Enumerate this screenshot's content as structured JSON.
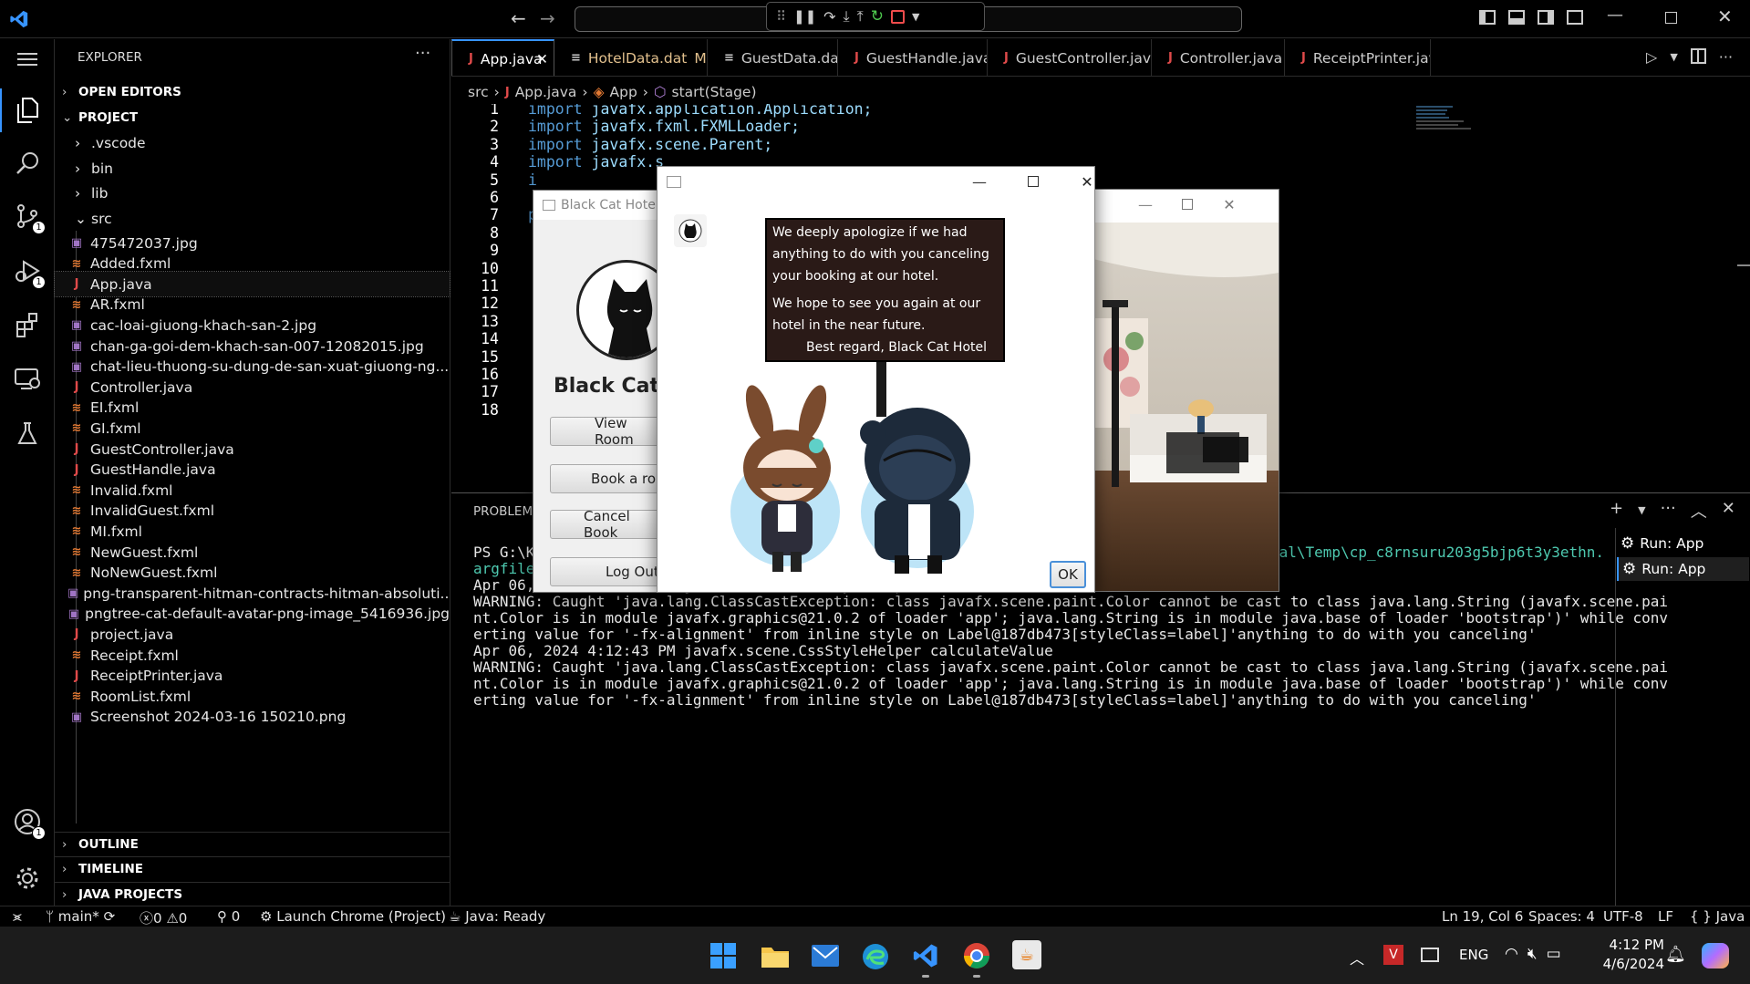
{
  "titlebar": {
    "back": "←",
    "forward": "→",
    "search_placeholder": "",
    "window_controls": [
      "minimize",
      "restore",
      "close"
    ]
  },
  "debug_toolbar": {
    "buttons": [
      "drag",
      "pause",
      "step-over",
      "step-into",
      "step-out",
      "restart",
      "stop"
    ]
  },
  "activity_bar": {
    "badges": {
      "source_control": "1",
      "run": "1",
      "accounts": "1"
    }
  },
  "explorer": {
    "title": "EXPLORER",
    "sections": {
      "open_editors": "OPEN EDITORS",
      "project": "PROJECT",
      "outline": "OUTLINE",
      "timeline": "TIMELINE",
      "java_projects": "JAVA PROJECTS"
    },
    "folders": [
      ".vscode",
      "bin",
      "lib",
      "src"
    ],
    "files": [
      {
        "name": "475472037.jpg",
        "type": "img"
      },
      {
        "name": "Added.fxml",
        "type": "xml"
      },
      {
        "name": "App.java",
        "type": "java"
      },
      {
        "name": "AR.fxml",
        "type": "xml"
      },
      {
        "name": "cac-loai-giuong-khach-san-2.jpg",
        "type": "img"
      },
      {
        "name": "chan-ga-goi-dem-khach-san-007-12082015.jpg",
        "type": "img"
      },
      {
        "name": "chat-lieu-thuong-su-dung-de-san-xuat-giuong-ng...",
        "type": "img"
      },
      {
        "name": "Controller.java",
        "type": "java"
      },
      {
        "name": "EI.fxml",
        "type": "xml"
      },
      {
        "name": "GI.fxml",
        "type": "xml"
      },
      {
        "name": "GuestController.java",
        "type": "java"
      },
      {
        "name": "GuestHandle.java",
        "type": "java"
      },
      {
        "name": "Invalid.fxml",
        "type": "xml"
      },
      {
        "name": "InvalidGuest.fxml",
        "type": "xml"
      },
      {
        "name": "MI.fxml",
        "type": "xml"
      },
      {
        "name": "NewGuest.fxml",
        "type": "xml"
      },
      {
        "name": "NoNewGuest.fxml",
        "type": "xml"
      },
      {
        "name": "png-transparent-hitman-contracts-hitman-absoluti...",
        "type": "img"
      },
      {
        "name": "pngtree-cat-default-avatar-png-image_5416936.jpg",
        "type": "img"
      },
      {
        "name": "project.java",
        "type": "java"
      },
      {
        "name": "Receipt.fxml",
        "type": "xml"
      },
      {
        "name": "ReceiptPrinter.java",
        "type": "java"
      },
      {
        "name": "RoomList.fxml",
        "type": "xml"
      },
      {
        "name": "Screenshot 2024-03-16 150210.png",
        "type": "img"
      }
    ]
  },
  "tabs": [
    {
      "label": "App.java",
      "type": "java",
      "active": true,
      "close": "✕"
    },
    {
      "label": "HotelData.dat",
      "type": "dat",
      "modified": "M"
    },
    {
      "label": "GuestData.dat",
      "type": "dat"
    },
    {
      "label": "GuestHandle.java",
      "type": "java"
    },
    {
      "label": "GuestController.java",
      "type": "java"
    },
    {
      "label": "Controller.java",
      "type": "java"
    },
    {
      "label": "ReceiptPrinter.java",
      "type": "java"
    }
  ],
  "breadcrumb": [
    "src",
    "App.java",
    "App",
    "start(Stage)"
  ],
  "editor": {
    "line_numbers": [
      "1",
      "2",
      "3",
      "4",
      "5",
      "6",
      "7",
      "8",
      "9",
      "10",
      "11",
      "12",
      "13",
      "14",
      "15",
      "16",
      "17",
      "18"
    ],
    "lines": [
      {
        "kw": "import",
        "rest": " javafx.application.Application;"
      },
      {
        "kw": "import",
        "rest": " javafx.fxml.FXMLLoader;"
      },
      {
        "kw": "import",
        "rest": " javafx.scene.Parent;"
      },
      {
        "kw": "import",
        "rest": " javafx.s"
      },
      {
        "kw": "i",
        "rest": ""
      },
      {
        "kw": "",
        "rest": ""
      },
      {
        "kw": "p",
        "rest": ""
      }
    ]
  },
  "panel": {
    "tab": "PROBLEMS",
    "terminal_lines": [
      "PS G:\\K",
      "argfile",
      "Apr 06, 2024 4:12:43 PM javafx.scene.CssStyleHelper calculateValue",
      "WARNING: Caught 'java.lang.ClassCastException: class javafx.scene.paint.Color cannot be cast to class java.lang.String (javafx.scene.pai",
      "nt.Color is in module javafx.graphics@21.0.2 of loader 'app'; java.lang.String is in module java.base of loader 'bootstrap')' while conv",
      "erting value for '-fx-alignment' from inline style on Label@187db473[styleClass=label]'anything to do with you canceling'",
      "Apr 06, 2024 4:12:43 PM javafx.scene.CssStyleHelper calculateValue",
      "WARNING: Caught 'java.lang.ClassCastException: class javafx.scene.paint.Color cannot be cast to class java.lang.String (javafx.scene.pai",
      "nt.Color is in module javafx.graphics@21.0.2 of loader 'app'; java.lang.String is in module java.base of loader 'bootstrap')' while conv",
      "erting value for '-fx-alignment' from inline style on Label@187db473[styleClass=label]'anything to do with you canceling'"
    ],
    "terminal_path_tail": "cal\\Temp\\cp_c8rnsuru203g5bjp6t3y3ethn.",
    "run_sessions": [
      "Run: App",
      "Run: App"
    ]
  },
  "statusbar": {
    "branch": "main*",
    "errors": "0",
    "warnings": "0",
    "ports": "0",
    "launch": "Launch Chrome (Project)",
    "java": "Java: Ready",
    "position": "Ln 19, Col 6",
    "spaces": "Spaces: 4",
    "encoding": "UTF-8",
    "eol": "LF",
    "language": "{ } Java"
  },
  "hotel_window": {
    "title": "Black Cat Hotel",
    "brand": "Black Cat H",
    "buttons": [
      "View Room",
      "Book a roo",
      "Cancel Book",
      "Log Out"
    ]
  },
  "dialog": {
    "message_p1": "We deeply apologize if we had anything to do with you canceling your booking at our hotel.",
    "message_p2": "We hope to see you again at our hotel in the near future.",
    "signature": "Best regard, Black Cat Hotel",
    "ok": "OK"
  },
  "taskbar": {
    "lang": "ENG",
    "time": "4:12 PM",
    "date": "4/6/2024"
  },
  "colors": {
    "accent": "#3794ff",
    "keyword": "#569cd6",
    "java_icon": "#e04a4a",
    "xml_icon": "#e37933",
    "dialog_note_bg": "#2a1a17"
  }
}
